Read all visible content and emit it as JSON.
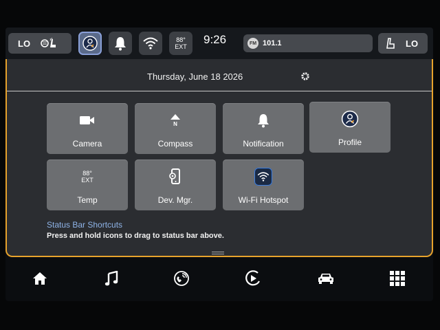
{
  "status_bar": {
    "left_temp": "LO",
    "right_temp": "LO",
    "time": "9:26",
    "exterior_temp": "88°",
    "exterior_label": "EXT",
    "radio": {
      "band": "FM",
      "frequency": "101.1"
    },
    "shortcut_icons": [
      "profile-icon",
      "notification-bell-icon",
      "wifi-hotspot-icon",
      "exterior-temp-icon"
    ]
  },
  "header": {
    "date": "Thursday, June 18 2026"
  },
  "tiles": [
    {
      "label": "Camera",
      "icon": "camera-icon"
    },
    {
      "label": "Compass",
      "icon": "compass-icon",
      "compass_letter": "N"
    },
    {
      "label": "Notification",
      "icon": "bell-icon"
    },
    {
      "label": "Profile",
      "icon": "profile-icon"
    },
    {
      "label": "Temp",
      "icon": "exterior-temp-icon",
      "temp": "88°",
      "temp_label": "EXT"
    },
    {
      "label": "Dev. Mgr.",
      "icon": "device-manager-icon"
    },
    {
      "label": "Wi-Fi Hotspot",
      "icon": "wifi-hotspot-icon"
    }
  ],
  "hint": {
    "title": "Status Bar Shortcuts",
    "text": "Press and hold icons to drag to status bar above."
  },
  "nav": [
    "home-icon",
    "music-icon",
    "phone-icon",
    "media-play-icon",
    "vehicle-icon",
    "apps-grid-icon"
  ],
  "colors": {
    "panel_border": "#e8a32c",
    "tile": "#6c6e71",
    "panel": "#2b2d31",
    "hint_title": "#8fb4e8"
  }
}
